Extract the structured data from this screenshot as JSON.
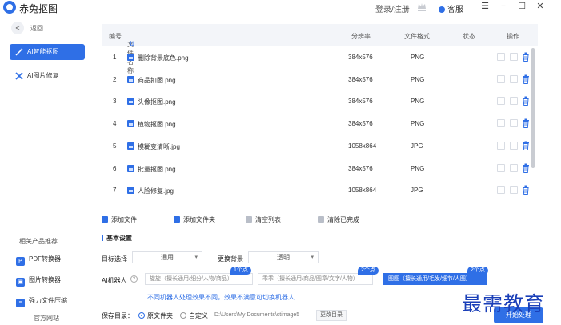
{
  "app": {
    "title": "赤兔抠图",
    "login": "登录/注册",
    "service": "客服"
  },
  "sidebar": {
    "back_label": "返回",
    "items": [
      {
        "label": "AI智能抠图",
        "active": true
      },
      {
        "label": "AI图片修复",
        "active": false
      }
    ],
    "related_title": "相关产品推荐",
    "products": [
      {
        "label": "PDF转换器"
      },
      {
        "label": "图片转换器"
      },
      {
        "label": "强力文件压缩"
      }
    ],
    "official_site": "官方网站"
  },
  "table": {
    "headers": {
      "num": "编号",
      "name": "文件名称",
      "resolution": "分辨率",
      "format": "文件格式",
      "status": "状态",
      "action": "操作"
    },
    "rows": [
      {
        "num": "1",
        "name": "删除背景底色.png",
        "resolution": "384x576",
        "format": "PNG",
        "status": ""
      },
      {
        "num": "2",
        "name": "商品扣图.png",
        "resolution": "384x576",
        "format": "PNG",
        "status": ""
      },
      {
        "num": "3",
        "name": "头像抠图.png",
        "resolution": "384x576",
        "format": "PNG",
        "status": ""
      },
      {
        "num": "4",
        "name": "植物抠图.png",
        "resolution": "384x576",
        "format": "PNG",
        "status": ""
      },
      {
        "num": "5",
        "name": "模糊变清晰.jpg",
        "resolution": "1058x864",
        "format": "JPG",
        "status": ""
      },
      {
        "num": "6",
        "name": "批量抠图.png",
        "resolution": "384x576",
        "format": "PNG",
        "status": ""
      },
      {
        "num": "7",
        "name": "人脸修复.jpg",
        "resolution": "1058x864",
        "format": "JPG",
        "status": ""
      }
    ]
  },
  "toolbar": {
    "add_file": "添加文件",
    "add_folder": "添加文件夹",
    "clear_list": "清空列表",
    "clear_done": "清除已完成"
  },
  "settings": {
    "title": "基本设置",
    "target_label": "目标选择",
    "target_value": "通用",
    "bg_label": "更换背景",
    "bg_value": "透明",
    "robot_label": "AI机器人",
    "robots": [
      {
        "text": "旋旋（擅长通用/细分/人物/商品）",
        "badge": "1个点",
        "selected": false
      },
      {
        "text": "乖乖（擅长通用/商品/图章/文字/人物）",
        "badge": "2个点",
        "selected": false
      },
      {
        "text": "图图（擅长通用/毛发/细节/人图）",
        "badge": "2个点",
        "selected": true
      }
    ],
    "hint": "不同机器人处理效果不同，效果不满意可切换机器人",
    "save_label": "保存目录：",
    "save_option_source": "原文件夹",
    "save_option_custom": "自定义",
    "save_path": "D:\\Users\\My Documents\\ctimage5",
    "change_dir": "更改目录",
    "start_button": "开始处理"
  },
  "watermark": "最需教育",
  "colors": {
    "accent": "#2f6fe6",
    "watermark": "#1a3fb8"
  }
}
